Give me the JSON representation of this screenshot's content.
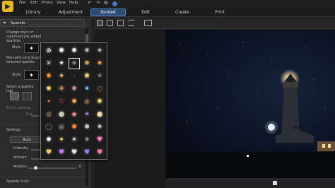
{
  "menu": [
    "File",
    "Edit",
    "Photo",
    "View",
    "Help"
  ],
  "tabs": [
    {
      "label": "Library"
    },
    {
      "label": "Adjustment"
    },
    {
      "label": "Guided"
    },
    {
      "label": "Edit"
    },
    {
      "label": "Create"
    },
    {
      "label": "Print"
    }
  ],
  "panel": {
    "title": "Sparkle",
    "instr1": "Change style of automatically added sparkles.",
    "style_label": "Style",
    "instr2a": "Manually click brush to add",
    "instr2b": "selected sparkle.",
    "style2_label": "Style",
    "tool_label": "Select a sparkle tool",
    "inbrush": "Brush settings",
    "size_label": "Size",
    "settings_label": "Settings",
    "mode_value": "Auto",
    "intensity_label": "Intensity",
    "amount_label": "Amount",
    "rotation_label": "Rotation",
    "rotation_value": "0",
    "color_label": "Sparkle Color"
  },
  "colors": {
    "accent": "#2c4a73",
    "bg": "#222222",
    "panel": "#2b2b2b"
  },
  "sparkles": [
    [
      "none-icon",
      "sparkle-white",
      "sparkle-soft",
      "sparkle-glow",
      "sparkle-star8"
    ],
    [
      "sparkle-x",
      "sparkle-long",
      "sparkle-boxed",
      "sparkle-warm",
      "sparkle-gold"
    ],
    [
      "sparkle-orange",
      "sparkle-ray",
      "sparkle-faint",
      "sparkle-amber",
      "sparkle-tiny"
    ],
    [
      "sparkle-yellow",
      "sparkle-cross",
      "sparkle-pink",
      "sparkle-cyan",
      "sparkle-ring"
    ],
    [
      "sparkle-dot",
      "sparkle-heart",
      "sparkle-fire",
      "sparkle-dim",
      "sparkle-multi"
    ],
    [
      "sparkle-haze",
      "sparkle-bokeh",
      "sparkle-rainbow",
      "sparkle-purple",
      "sparkle-orb"
    ],
    [
      "sparkle-ring2",
      "sparkle-ringglow",
      "sparkle-ember",
      "sparkle-snowflake",
      "sparkle-cluster"
    ],
    [
      "sparkle-starfull",
      "sparkle-spark",
      "sparkle-starpair",
      "sparkle-stars",
      "sparkle-heartglow"
    ],
    [
      "sparkle-heart-gold",
      "sparkle-heart-purple",
      "sparkle-heart-white",
      "sparkle-heart-violet",
      "sparkle-heart-pink"
    ]
  ]
}
